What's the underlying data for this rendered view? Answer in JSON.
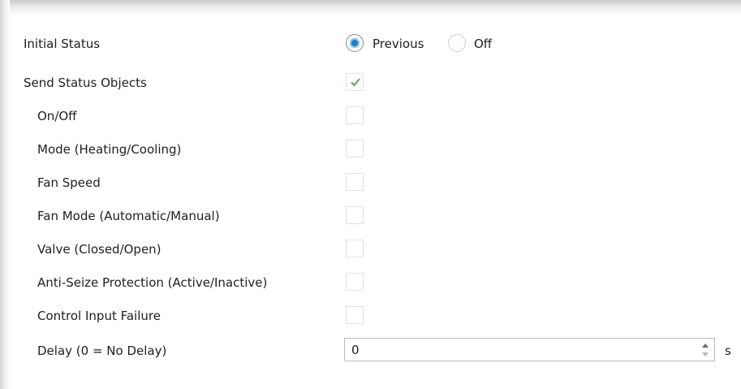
{
  "initial_status": {
    "label": "Initial Status",
    "options": [
      "Previous",
      "Off"
    ],
    "selected": "Previous"
  },
  "send_status_objects": {
    "label": "Send Status Objects",
    "checked": true
  },
  "sub_objects": [
    {
      "label": "On/Off",
      "checked": false
    },
    {
      "label": "Mode (Heating/Cooling)",
      "checked": false
    },
    {
      "label": "Fan Speed",
      "checked": false
    },
    {
      "label": "Fan Mode (Automatic/Manual)",
      "checked": false
    },
    {
      "label": "Valve (Closed/Open)",
      "checked": false
    },
    {
      "label": "Anti-Seize Protection (Active/Inactive)",
      "checked": false
    },
    {
      "label": "Control Input Failure",
      "checked": false
    }
  ],
  "delay": {
    "label": "Delay (0 = No Delay)",
    "value": "0",
    "unit": "s"
  },
  "colors": {
    "radio_selected": "#1e7ec8",
    "checkmark": "#5aa85a",
    "checkbox_border": "#e2e2e2"
  }
}
